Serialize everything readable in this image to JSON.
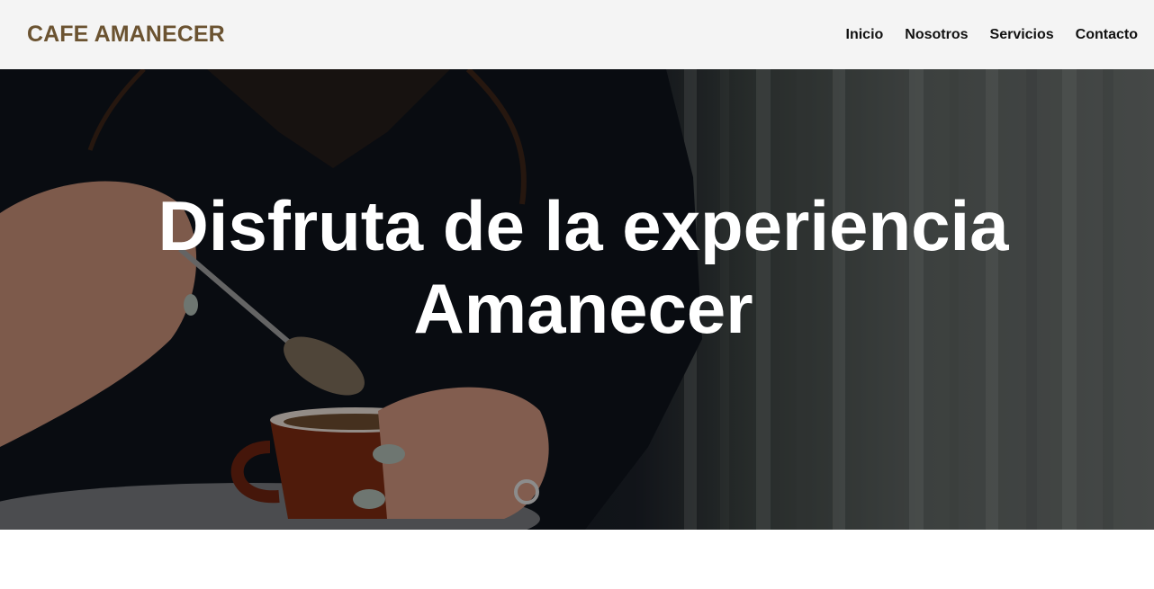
{
  "header": {
    "brand": "CAFE AMANECER",
    "nav": [
      {
        "label": "Inicio"
      },
      {
        "label": "Nosotros"
      },
      {
        "label": "Servicios"
      },
      {
        "label": "Contacto"
      }
    ]
  },
  "hero": {
    "title": "Disfruta de la experiencia Amanecer"
  },
  "colors": {
    "brand": "#6b5331",
    "nav_background": "#f4f4f4",
    "hero_text": "#ffffff"
  }
}
